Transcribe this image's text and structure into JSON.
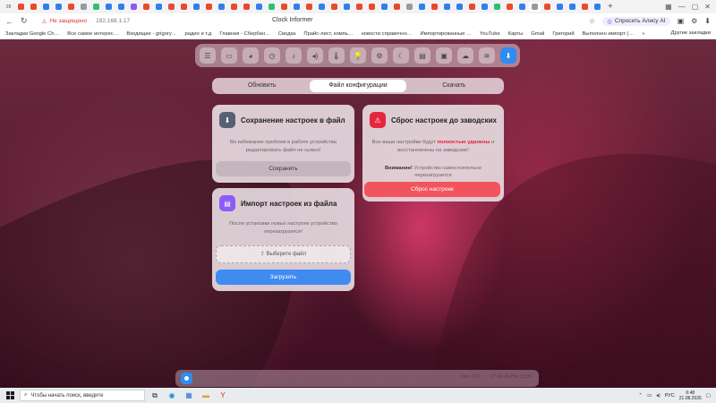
{
  "browser": {
    "tab_number": "28",
    "tab_favicons": [
      "#e84a2a",
      "#e84a2a",
      "#2f80ed",
      "#2f80ed",
      "#e84a2a",
      "#999999",
      "#2fbf71",
      "#2f80ed",
      "#2f80ed",
      "#8a5cf6",
      "#e84a2a",
      "#2f80ed",
      "#e84a2a",
      "#e84a2a",
      "#2f80ed",
      "#e84a2a",
      "#2f80ed",
      "#e84a2a",
      "#e84a2a",
      "#2f80ed",
      "#2fbf71",
      "#e84a2a",
      "#2f80ed",
      "#e84a2a",
      "#2f80ed",
      "#e84a2a",
      "#2f80ed",
      "#e84a2a",
      "#e84a2a",
      "#2f80ed",
      "#e84a2a",
      "#999999",
      "#2f80ed",
      "#e84a2a",
      "#2f80ed",
      "#2f80ed",
      "#e84a2a",
      "#2f80ed",
      "#2fbf71",
      "#e84a2a",
      "#2f80ed",
      "#999999",
      "#e84a2a",
      "#2f80ed",
      "#2f80ed",
      "#e84a2a",
      "#2f80ed"
    ],
    "new_tab": "+",
    "security": "Не защищено",
    "url": "192.168.1.17",
    "page_title": "Clock Informer",
    "alice_label": "Спросить Алису AI",
    "bookmarks": [
      "Закладки Google Ch…",
      "Все самое интерес…",
      "Входящие - grigory…",
      "радио и т.д",
      "Главная - Сбербан…",
      "Сводка",
      "Прайс-лист, компь…",
      "новости справочно…",
      "Импортированные …",
      "YouTube",
      "Карты",
      "Gmail",
      "Григорий",
      "Выполнен импорт (…"
    ],
    "bookmarks_more": "»",
    "other_bookmarks": "Другие закладки"
  },
  "toolbar": {
    "icons": [
      "menu-icon",
      "monitor-icon",
      "palette-icon",
      "clock-icon",
      "bell-icon",
      "volume-icon",
      "thermometer-icon",
      "bulb-icon",
      "network-icon",
      "moon-icon",
      "display-icon",
      "image-icon",
      "cloud-icon",
      "wifi-icon",
      "download-icon"
    ],
    "glyphs": [
      "☰",
      "▭",
      "◕",
      "◷",
      "♪",
      "◂)",
      "🌡",
      "💡",
      "⚙",
      "☾",
      "▤",
      "▣",
      "☁",
      "≋",
      "⬇"
    ]
  },
  "tabs": {
    "refresh": "Обновить",
    "config": "Файл конфигурации",
    "download": "Скачать"
  },
  "save_card": {
    "title": "Сохранение настроек в файл",
    "text": "Во избежание проблем в работе устройства редактировать файл не нужно!",
    "button": "Сохранить"
  },
  "import_card": {
    "title": "Импорт настроек из файла",
    "text": "После установки новых настроек устройство перезагрузится!",
    "choose": "Выберите файл",
    "button": "Загрузить"
  },
  "reset_card": {
    "title": "Сброс настроек до заводских",
    "text_before": "Все ваши настройки будут ",
    "text_highlight": "полностью удалены",
    "text_after": " и восстановлены на заводские!",
    "warn_label": "Внимание!",
    "warn_text": " Устройство самостоятельно перезагрузится",
    "button": "Сброс настроек"
  },
  "statusbar": {
    "info1": "Окт +21°",
    "info2": "17:41:45 PM 13:36"
  },
  "taskbar": {
    "search_placeholder": "Чтобы начать поиск, введите",
    "lang": "РУС",
    "time": "6:48",
    "date": "21.08.2026"
  }
}
